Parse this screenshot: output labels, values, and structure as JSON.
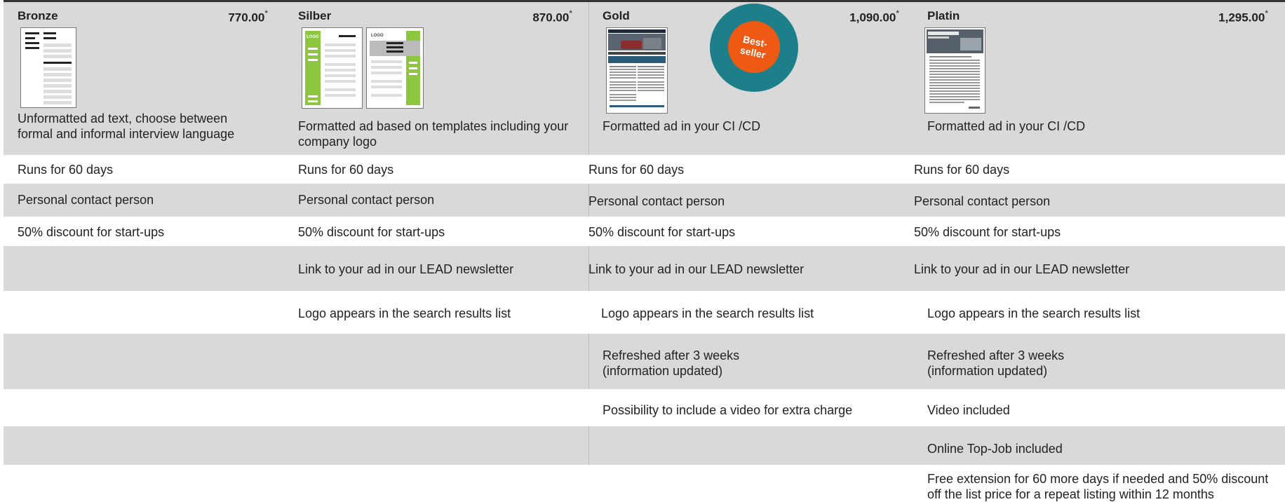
{
  "tiers": [
    {
      "name": "Bronze",
      "price": "770.00",
      "mark": "*",
      "description": "Unformatted ad text, choose between formal and informal interview language"
    },
    {
      "name": "Silber",
      "price": "870.00",
      "mark": "*",
      "description": "Formatted ad based on templates including your company logo"
    },
    {
      "name": "Gold",
      "price": "1,090.00",
      "mark": "*",
      "description": "Formatted ad in your CI /CD"
    },
    {
      "name": "Platin",
      "price": "1,295.00",
      "mark": "*",
      "description": "Formatted ad in your CI /CD"
    }
  ],
  "badge": {
    "line1": "Best-",
    "line2": "seller"
  },
  "thumb_labels": {
    "logo": "LOGO"
  },
  "features": {
    "runs": "Runs for 60 days",
    "contact": "Personal contact person",
    "discount": "50% discount for start-ups",
    "newsletter": "Link to your ad in our LEAD newsletter",
    "logo": "Logo appears in the search results list",
    "refresh_1": "Refreshed after 3 weeks",
    "refresh_2": "(information updated)",
    "video_extra": "Possibility to include a video for extra charge",
    "video_included": "Video included",
    "topjob": "Online Top-Job included",
    "extension_1": "Free extension for 60 more days if needed and 50% discount",
    "extension_2": "off the list price for a repeat listing within 12 months"
  },
  "colors": {
    "band": "#d9d9d9",
    "badge_ring": "#1c7f8a",
    "badge_core": "#ee5a14",
    "template_green": "#8dc63f"
  }
}
